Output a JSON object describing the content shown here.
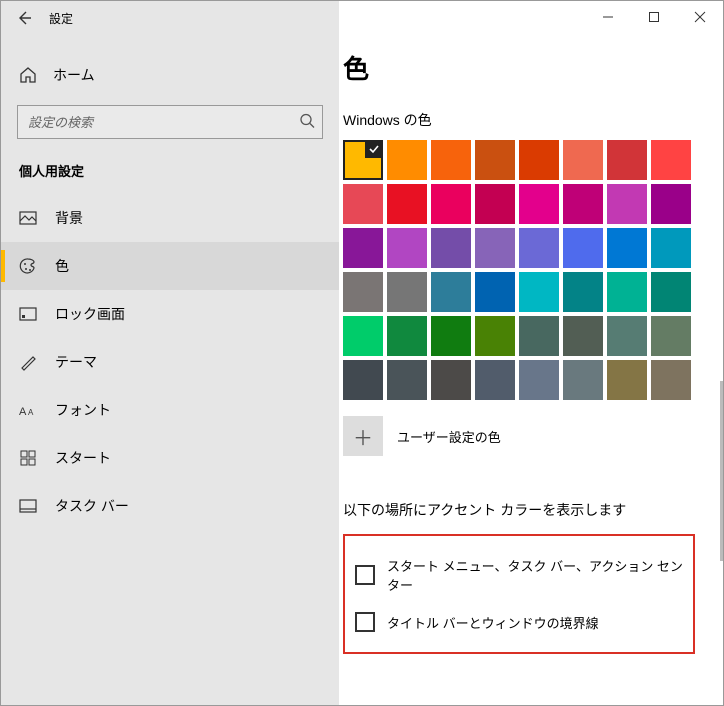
{
  "window": {
    "title": "設定"
  },
  "sidebar": {
    "home_label": "ホーム",
    "search_placeholder": "設定の検索",
    "category": "個人用設定",
    "items": [
      {
        "label": "背景"
      },
      {
        "label": "色"
      },
      {
        "label": "ロック画面"
      },
      {
        "label": "テーマ"
      },
      {
        "label": "フォント"
      },
      {
        "label": "スタート"
      },
      {
        "label": "タスク バー"
      }
    ]
  },
  "main": {
    "heading": "色",
    "windows_colors_label": "Windows の色",
    "colors": [
      [
        "#ffb900",
        "#ff8c00",
        "#f7630c",
        "#ca5010",
        "#da3b01",
        "#ef6950",
        "#d13438",
        "#ff4343"
      ],
      [
        "#e74856",
        "#e81123",
        "#ea005e",
        "#c30052",
        "#e3008c",
        "#bf0077",
        "#c239b3",
        "#9a0089"
      ],
      [
        "#881798",
        "#b146c2",
        "#744da9",
        "#8764b8",
        "#6b69d6",
        "#4f6bed",
        "#0078d4",
        "#0099bc"
      ],
      [
        "#7a7574",
        "#767676",
        "#2d7d9a",
        "#0063b1",
        "#00b7c3",
        "#038387",
        "#00b294",
        "#018574"
      ],
      [
        "#00cc6a",
        "#10893e",
        "#107c10",
        "#498205",
        "#486860",
        "#525e54",
        "#567c73",
        "#647c64"
      ],
      [
        "#414950",
        "#4a5459",
        "#4c4a48",
        "#515c6b",
        "#68768a",
        "#69797e",
        "#847545",
        "#7e735f"
      ]
    ],
    "selected_color_index": 0,
    "custom_color_label": "ユーザー設定の色",
    "accent_surfaces_title": "以下の場所にアクセント カラーを表示します",
    "checkboxes": [
      {
        "label": "スタート メニュー、タスク バー、アクション センター",
        "checked": false
      },
      {
        "label": "タイトル バーとウィンドウの境界線",
        "checked": false
      }
    ]
  }
}
